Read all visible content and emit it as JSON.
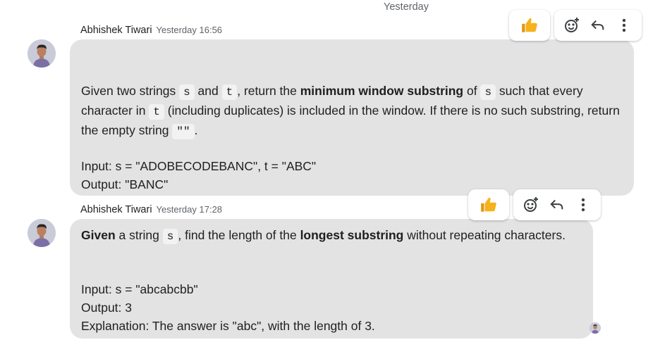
{
  "divider": {
    "label": "Yesterday"
  },
  "messages": [
    {
      "sender": "Abhishek Tiwari",
      "time": "Yesterday 16:56",
      "p1": {
        "a": "Given two strings ",
        "code_s": "s",
        "b": " and ",
        "code_t": "t",
        "c": ", return the ",
        "bold": "minimum window substring",
        "d": " of ",
        "code_s2": "s",
        "e": " such that every character in ",
        "code_t2": "t",
        "f": " (including duplicates) is included in the window. If there is no such substring, return the empty string ",
        "code_empty": "\"\"",
        "g": "."
      },
      "input_line": "Input: s = \"ADOBECODEBANC\", t = \"ABC\"",
      "output_line": "Output: \"BANC\""
    },
    {
      "sender": "Abhishek Tiwari",
      "time": "Yesterday 17:28",
      "p1": {
        "bold1": "Given",
        "a": " a string ",
        "code_s": "s",
        "b": ", find the length of the ",
        "bold2": "longest substring",
        "c": " without repeating characters."
      },
      "input_line": "Input: s = \"abcabcbb\"",
      "output_line": "Output: 3",
      "explanation_line": "Explanation: The answer is \"abc\", with the length of 3."
    }
  ],
  "toolbar_icons": [
    "thumbs-up-icon",
    "add-reaction-icon",
    "reply-icon",
    "more-vert-icon"
  ],
  "colors": {
    "bubble": "#e3e3e3",
    "thumb": "#f6b21c"
  }
}
